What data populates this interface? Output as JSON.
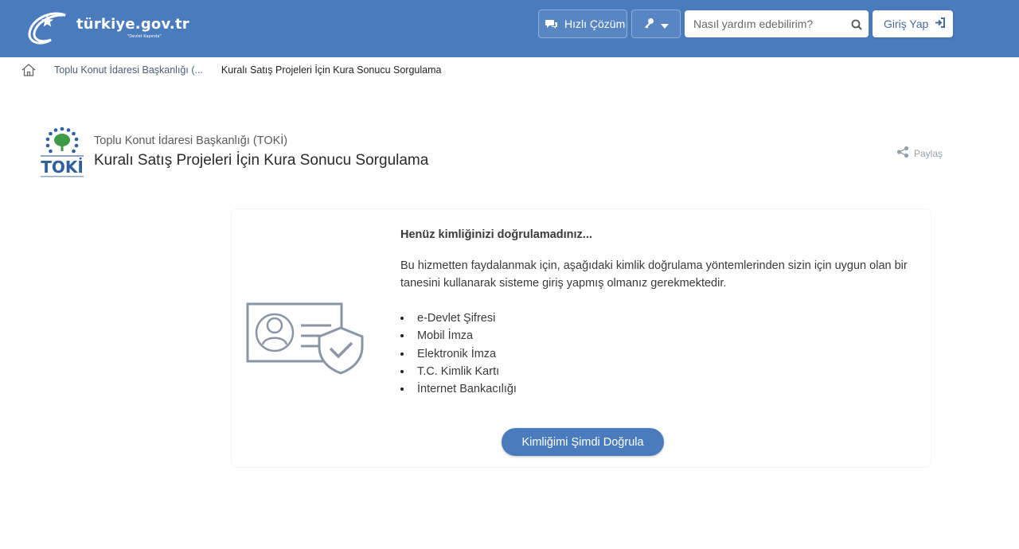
{
  "header": {
    "logo_text": "türkiye.gov.tr",
    "logo_tagline": "\"Devlet Kapında\"",
    "quick_solution_label": "Hızlı Çözüm",
    "search_placeholder": "Nasıl yardım edebilirim?",
    "login_label": "Giriş Yap",
    "accent_color": "#4a7cbd"
  },
  "breadcrumb": {
    "items": [
      "Toplu Konut İdaresi Başkanlığı (...",
      "Kuralı Satış Projeleri İçin Kura Sonucu Sorgulama"
    ]
  },
  "service": {
    "agency_name": "Toplu Konut İdaresi Başkanlığı (TOKİ)",
    "title": "Kuralı Satış Projeleri İçin Kura Sonucu Sorgulama",
    "share_label": "Paylaş",
    "agency_logo_text": "TOKİ"
  },
  "auth_notice": {
    "title": "Henüz kimliğinizi doğrulamadınız...",
    "body": "Bu hizmetten faydalanmak için, aşağıdaki kimlik doğrulama yöntemlerinden sizin için uygun olan bir tanesini kullanarak sisteme giriş yapmış olmanız gerekmektedir.",
    "methods": [
      "e-Devlet Şifresi",
      "Mobil İmza",
      "Elektronik İmza",
      "T.C. Kimlik Kartı",
      "İnternet Bankacılığı"
    ],
    "verify_button_label": "Kimliğimi Şimdi Doğrula"
  },
  "icons": [
    "home-icon",
    "chat-icon",
    "key-icon",
    "chevron-down-icon",
    "search-icon",
    "login-arrow-icon",
    "share-icon",
    "id-card-shield-icon"
  ]
}
